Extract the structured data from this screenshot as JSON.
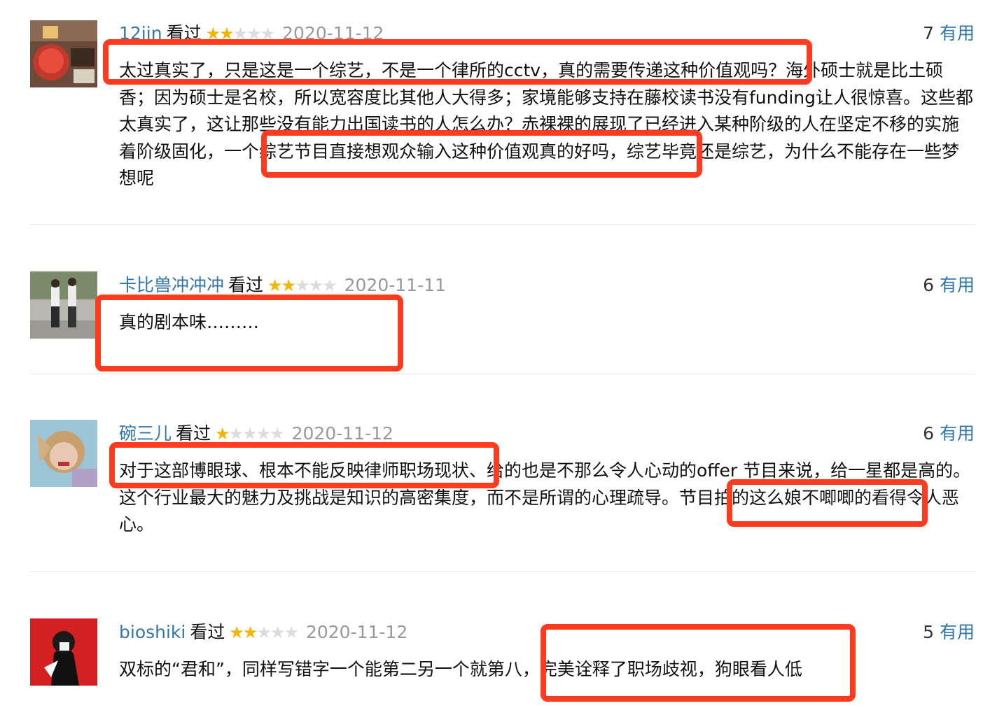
{
  "comments": [
    {
      "username": "12jin",
      "status": "看过",
      "rating": 2,
      "date": "2020-11-12",
      "votes": "7",
      "useful_label": "有用",
      "content": "太过真实了，只是这是一个综艺，不是一个律所的cctv，真的需要传递这种价值观吗？海外硕士就是比土硕香；因为硕士是名校，所以宽容度比其他人大得多；家境能够支持在藤校读书没有funding让人很惊喜。这些都太真实了，这让那些没有能力出国读书的人怎么办？赤裸裸的展现了已经进入某种阶级的人在坚定不移的实施着阶级固化，一个综艺节目直接想观众输入这种价值观真的好吗，综艺毕竟还是综艺，为什么不能存在一些梦想呢"
    },
    {
      "username": "卡比兽冲冲冲",
      "status": "看过",
      "rating": 2,
      "date": "2020-11-11",
      "votes": "6",
      "useful_label": "有用",
      "content": "真的剧本味………"
    },
    {
      "username": "碗三儿",
      "status": "看过",
      "rating": 1,
      "date": "2020-11-12",
      "votes": "6",
      "useful_label": "有用",
      "content": "对于这部博眼球、根本不能反映律师职场现状、给的也是不那么令人心动的offer 节目来说，给一星都是高的。这个行业最大的魅力及挑战是知识的高密集度，而不是所谓的心理疏导。节目拍的这么娘不唧唧的看得令人恶心。"
    },
    {
      "username": "bioshiki",
      "status": "看过",
      "rating": 2,
      "date": "2020-11-12",
      "votes": "5",
      "useful_label": "有用",
      "content": "双标的“君和”，同样写错字一个能第二另一个就第八，完美诠释了职场歧视，狗眼看人低"
    }
  ],
  "colors": {
    "link": "#3377aa",
    "highlight": "#ff3b1f",
    "star": "#f5b400",
    "star_empty": "#dcdcdc",
    "date": "#999999"
  }
}
